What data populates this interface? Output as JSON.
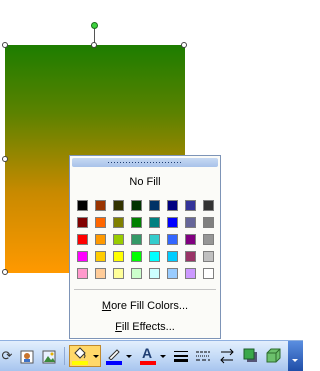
{
  "popup": {
    "no_fill_label": "No Fill",
    "more_colors_label": "More Fill Colors...",
    "fill_effects_label": "Fill Effects...",
    "swatches": [
      "#000000",
      "#993300",
      "#333300",
      "#003300",
      "#003366",
      "#000080",
      "#333399",
      "#333333",
      "#800000",
      "#ff6600",
      "#808000",
      "#008000",
      "#008080",
      "#0000ff",
      "#666699",
      "#808080",
      "#ff0000",
      "#ff9900",
      "#99cc00",
      "#339966",
      "#33cccc",
      "#3366ff",
      "#800080",
      "#969696",
      "#ff00ff",
      "#ffcc00",
      "#ffff00",
      "#00ff00",
      "#00ffff",
      "#00ccff",
      "#993366",
      "#c0c0c0",
      "#ff99cc",
      "#ffcc99",
      "#ffff99",
      "#ccffcc",
      "#ccffff",
      "#99ccff",
      "#cc99ff",
      "#ffffff"
    ]
  },
  "toolbar": {
    "fill_color": "#ffff00",
    "line_color": "#0000ff",
    "font_color": "#ff0000",
    "font_color_glyph": "A"
  }
}
